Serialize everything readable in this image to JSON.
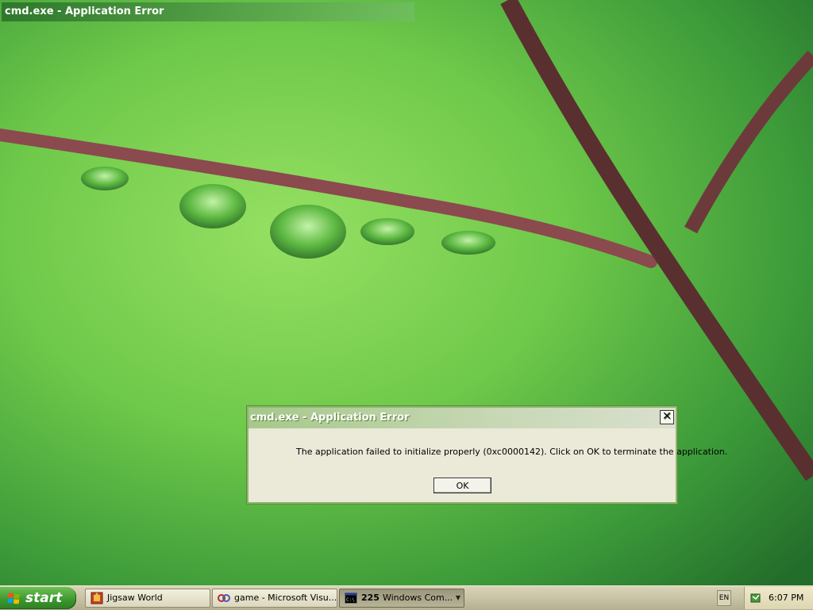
{
  "desktop": {
    "ghost_title": "cmd.exe - Application Error"
  },
  "dialog": {
    "title": "cmd.exe - Application Error",
    "close_glyph": "✕",
    "message": "The application failed to initialize properly (0xc0000142). Click on OK to terminate the application.",
    "ok_label": "OK"
  },
  "taskbar": {
    "start_label": "start",
    "tasks": [
      {
        "label": "Jigsaw World",
        "icon": "jigsaw-icon"
      },
      {
        "label": "game - Microsoft Visu...",
        "icon": "visual-studio-icon"
      },
      {
        "count": "225",
        "label": "Windows Com...",
        "icon": "cmd-icon",
        "active": true
      }
    ],
    "language": "EN",
    "clock": "6:07 PM"
  },
  "colors": {
    "wallpaper_green": "#6cc846",
    "dialog_bg": "#ebe9d8",
    "titlebar_green": "#a6c88a",
    "taskbar_bg": "#d9d4b8",
    "start_green": "#3d9a2e"
  }
}
